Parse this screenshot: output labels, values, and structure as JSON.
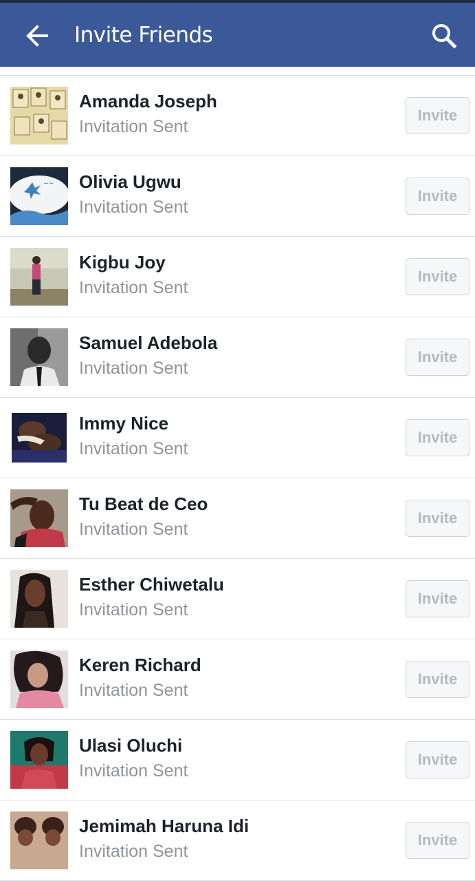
{
  "header": {
    "title": "Invite Friends",
    "back_icon": "arrow-left-icon",
    "search_icon": "search-icon",
    "color": "#3b5998"
  },
  "friends": [
    {
      "name": "Amanda Joseph",
      "status": "Invitation Sent",
      "button": "Invite"
    },
    {
      "name": "Olivia Ugwu",
      "status": "Invitation Sent",
      "button": "Invite"
    },
    {
      "name": "Kigbu Joy",
      "status": "Invitation Sent",
      "button": "Invite"
    },
    {
      "name": "Samuel Adebola",
      "status": "Invitation Sent",
      "button": "Invite"
    },
    {
      "name": "Immy Nice",
      "status": "Invitation Sent",
      "button": "Invite"
    },
    {
      "name": "Tu Beat de Ceo",
      "status": "Invitation Sent",
      "button": "Invite"
    },
    {
      "name": "Esther Chiwetalu",
      "status": "Invitation Sent",
      "button": "Invite"
    },
    {
      "name": "Keren Richard",
      "status": "Invitation Sent",
      "button": "Invite"
    },
    {
      "name": "Ulasi Oluchi",
      "status": "Invitation Sent",
      "button": "Invite"
    },
    {
      "name": "Jemimah Haruna Idi",
      "status": "Invitation Sent",
      "button": "Invite"
    }
  ]
}
